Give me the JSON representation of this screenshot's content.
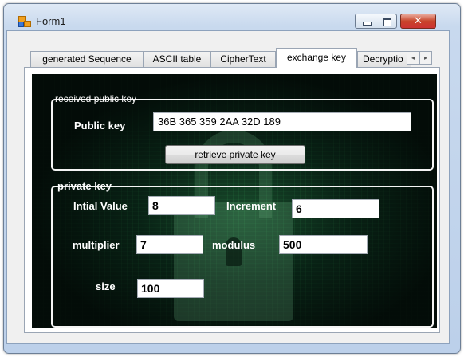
{
  "window": {
    "title": "Form1",
    "icon": "winforms-app-icon"
  },
  "titlebar_controls": {
    "minimize": "minimize-icon",
    "maximize": "maximize-icon",
    "close": "✕"
  },
  "tabs": [
    {
      "label": "generated Sequence",
      "active": false
    },
    {
      "label": "ASCII table",
      "active": false
    },
    {
      "label": "CipherText",
      "active": false
    },
    {
      "label": "exchange key",
      "active": true
    },
    {
      "label": "Decryptio",
      "active": false
    }
  ],
  "tab_scroll": {
    "left": "◂",
    "right": "▸"
  },
  "received_group": {
    "legend": "received public key",
    "public_key_label": "Public key",
    "public_key_value": "36B 365 359 2AA 32D 189",
    "retrieve_button": "retrieve private key"
  },
  "private_group": {
    "legend": "private key",
    "initial_value_label": "Intial Value",
    "initial_value": "8",
    "increment_label": "Increment",
    "increment": "6",
    "multiplier_label": "multiplier",
    "multiplier": "7",
    "modulus_label": "modulus",
    "modulus": "500",
    "size_label": "size",
    "size": "100"
  },
  "colors": {
    "background_theme": "#05120b",
    "group_border": "#f4f4f4",
    "label_text": "#ffffff"
  }
}
